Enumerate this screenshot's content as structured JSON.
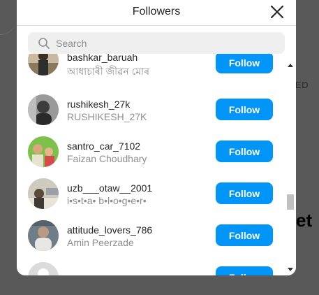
{
  "modal": {
    "title": "Followers",
    "close_icon": "close-icon"
  },
  "search": {
    "placeholder": "Search",
    "value": "",
    "icon": "search-icon"
  },
  "background": {
    "text_right_top": "ED",
    "text_right_bottom": "et"
  },
  "colors": {
    "follow_button": "#0095f6",
    "overlay": "#595959",
    "secondary_text": "#8e8e8e"
  },
  "followers": [
    {
      "username": "bashkar_baruah",
      "full_name": "আধাচাৰী জীৱন মোৰ",
      "button_label": "Follow"
    },
    {
      "username": "rushikesh_27k",
      "full_name": "RUSHIKESH_27K",
      "button_label": "Follow"
    },
    {
      "username": "santro_car_7102",
      "full_name": "Faizan Choudhary",
      "button_label": "Follow"
    },
    {
      "username": "uzb___otaw__2001",
      "full_name": "i•s•t•a• b•l•o•g•e•r•",
      "button_label": "Follow"
    },
    {
      "username": "attitude_lovers_786",
      "full_name": "Amin Peerzade",
      "button_label": "Follow"
    },
    {
      "username": "",
      "full_name": "",
      "button_label": "Follow"
    }
  ]
}
